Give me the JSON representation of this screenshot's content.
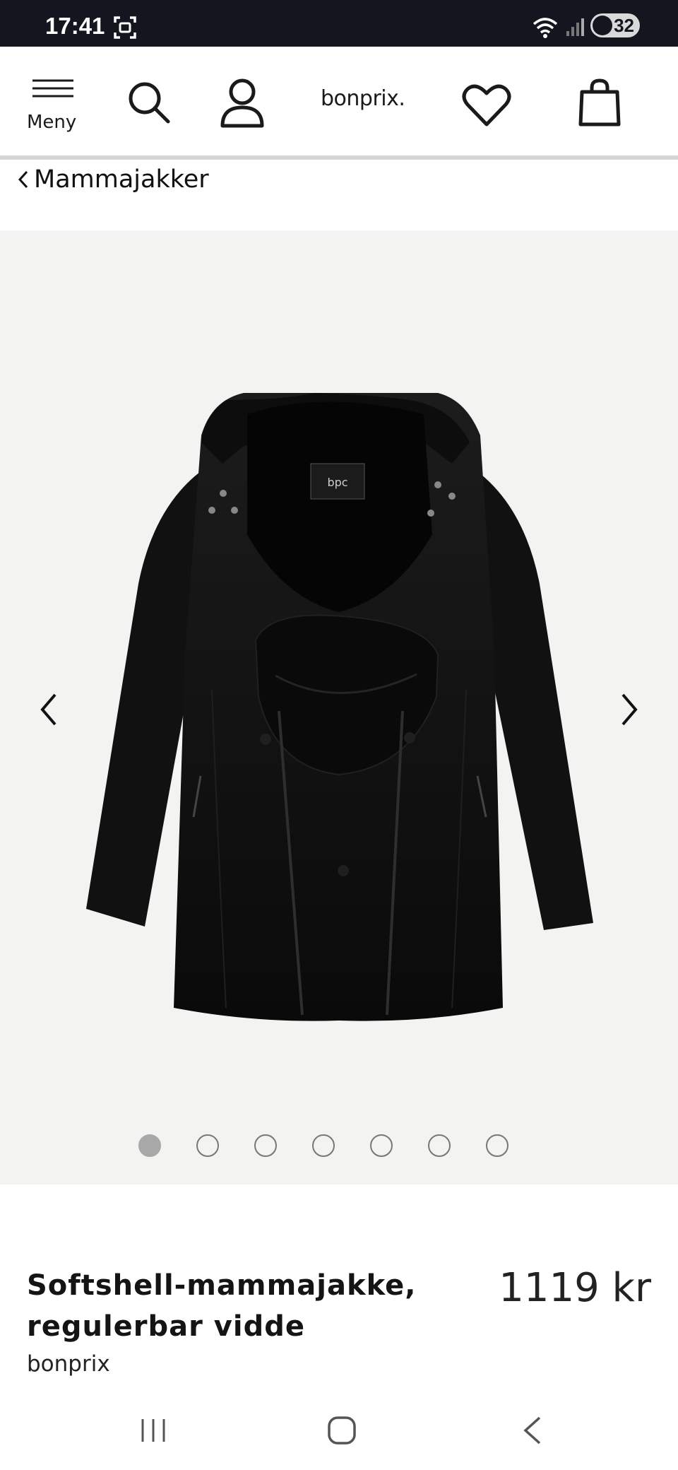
{
  "status_bar": {
    "time": "17:41",
    "battery": "32",
    "icons": [
      "screenshot-icon",
      "wifi-icon",
      "signal-icon",
      "battery-icon"
    ]
  },
  "header": {
    "menu_label": "Meny",
    "logo": "bonprix.",
    "icons": [
      "menu-icon",
      "search-icon",
      "account-icon",
      "heart-icon",
      "bag-icon"
    ]
  },
  "breadcrumb": {
    "label": "Mammajakker"
  },
  "gallery": {
    "image": "black softshell maternity jacket with baby insert and hood",
    "image_count": 7,
    "active_index": 0
  },
  "product": {
    "title_line1": "Softshell-mammajakke,",
    "title_line2": "regulerbar vidde",
    "brand": "bonprix",
    "price": "1119 kr"
  },
  "nav_bar": {
    "icons": [
      "recent-apps-icon",
      "home-icon",
      "back-icon"
    ]
  },
  "colors": {
    "status_bar_bg": "#13151f",
    "gallery_bg": "#f3f3f2",
    "jacket": "#111111"
  }
}
